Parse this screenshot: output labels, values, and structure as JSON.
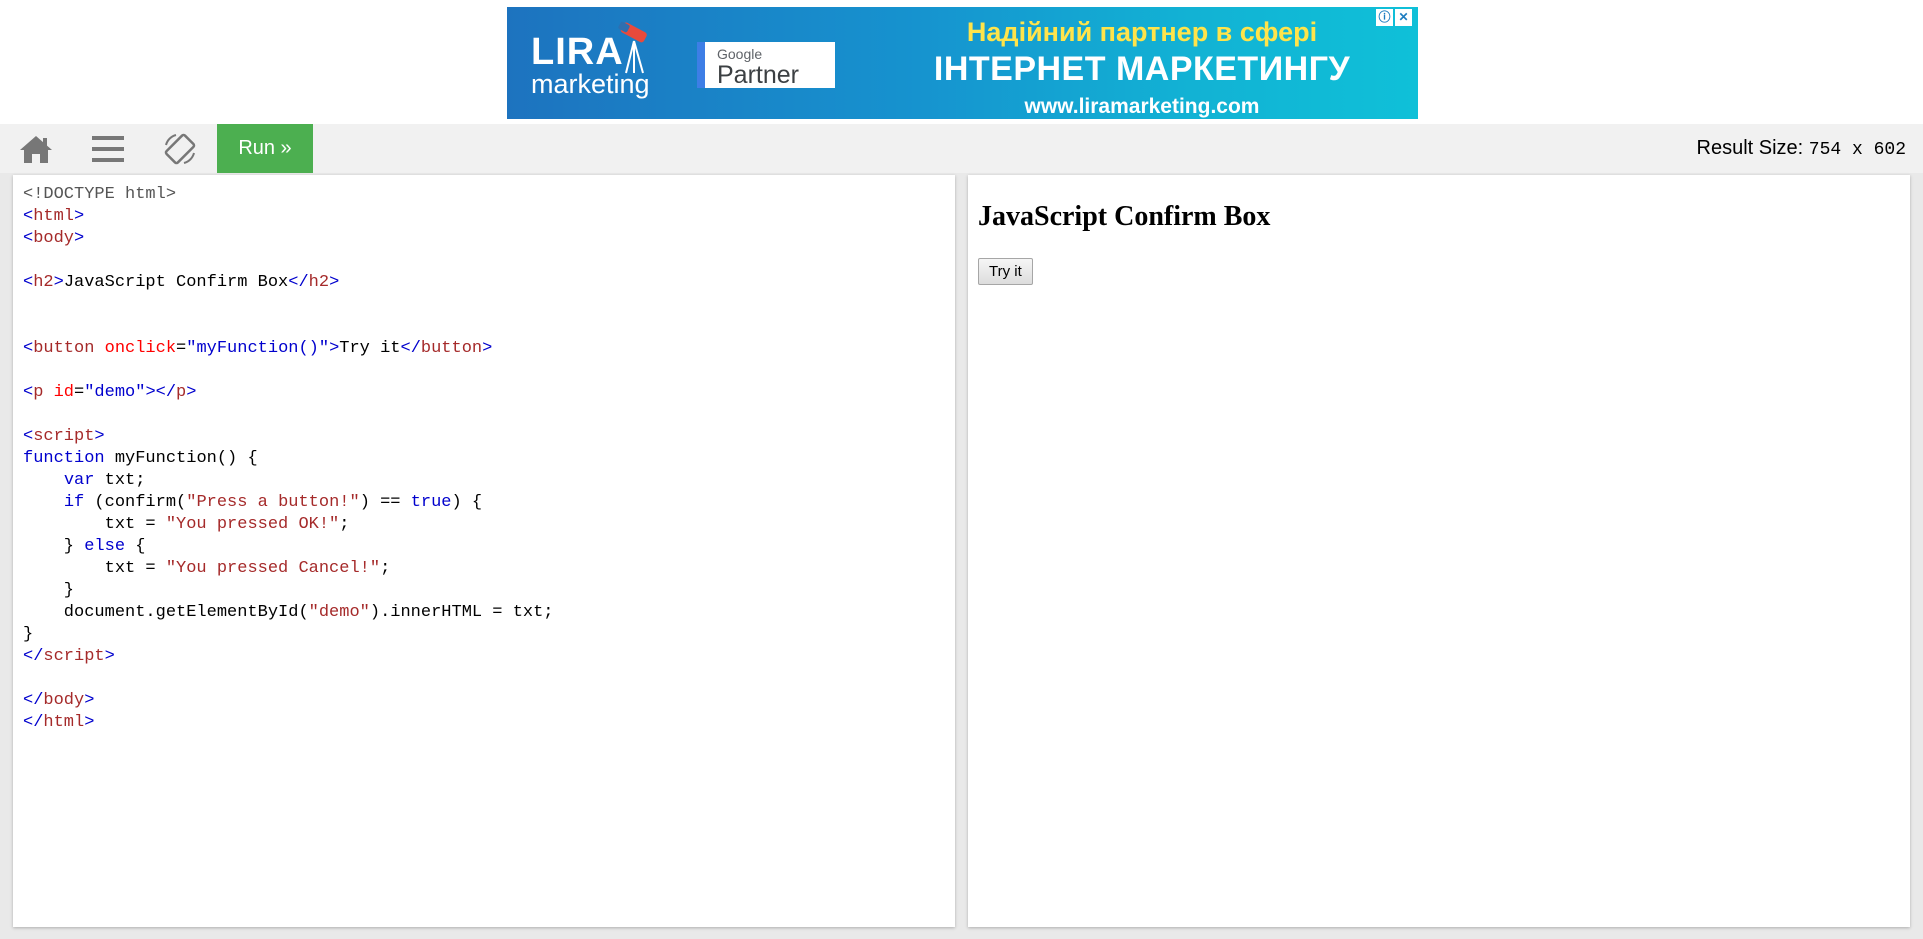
{
  "ad": {
    "logo_main": "LIRA",
    "logo_sub": "marketing",
    "partner_google": "Google",
    "partner_label": "Partner",
    "headline_line1": "Надійний партнер в сфері",
    "headline_line2": "ІНТЕРНЕТ МАРКЕТИНГУ",
    "headline_line3": "www.liramarketing.com",
    "info_glyph": "ⓘ",
    "close_glyph": "✕"
  },
  "toolbar": {
    "home_icon": "home-icon",
    "menu_icon": "menu-icon",
    "rotate_icon": "rotate-icon",
    "run_label": "Run »",
    "result_size_label": "Result Size:",
    "result_size_value": "754 x 602"
  },
  "colors": {
    "run_button": "#4caf50",
    "toolbar_bg": "#f1f1f1",
    "code_tag": "#0000cd",
    "code_name": "#a52a2a",
    "code_attr": "#ff0000"
  },
  "code_lines": [
    [
      [
        "doc",
        "<!DOCTYPE html>"
      ]
    ],
    [
      [
        "tag",
        "<"
      ],
      [
        "name",
        "html"
      ],
      [
        "tag",
        ">"
      ]
    ],
    [
      [
        "tag",
        "<"
      ],
      [
        "name",
        "body"
      ],
      [
        "tag",
        ">"
      ]
    ],
    [],
    [
      [
        "tag",
        "<"
      ],
      [
        "name",
        "h2"
      ],
      [
        "tag",
        ">"
      ],
      [
        "plain",
        "JavaScript Confirm Box"
      ],
      [
        "tag",
        "</"
      ],
      [
        "name",
        "h2"
      ],
      [
        "tag",
        ">"
      ]
    ],
    [],
    [],
    [
      [
        "tag",
        "<"
      ],
      [
        "name",
        "button"
      ],
      [
        "plain",
        " "
      ],
      [
        "attr",
        "onclick"
      ],
      [
        "plain",
        "="
      ],
      [
        "val",
        "\"myFunction()\""
      ],
      [
        "tag",
        ">"
      ],
      [
        "plain",
        "Try it"
      ],
      [
        "tag",
        "</"
      ],
      [
        "name",
        "button"
      ],
      [
        "tag",
        ">"
      ]
    ],
    [],
    [
      [
        "tag",
        "<"
      ],
      [
        "name",
        "p"
      ],
      [
        "plain",
        " "
      ],
      [
        "attr",
        "id"
      ],
      [
        "plain",
        "="
      ],
      [
        "val",
        "\"demo\""
      ],
      [
        "tag",
        "></"
      ],
      [
        "name",
        "p"
      ],
      [
        "tag",
        ">"
      ]
    ],
    [],
    [
      [
        "tag",
        "<"
      ],
      [
        "name",
        "script"
      ],
      [
        "tag",
        ">"
      ]
    ],
    [
      [
        "kw",
        "function"
      ],
      [
        "plain",
        " myFunction() {"
      ]
    ],
    [
      [
        "plain",
        "    "
      ],
      [
        "kw",
        "var"
      ],
      [
        "plain",
        " txt;"
      ]
    ],
    [
      [
        "plain",
        "    "
      ],
      [
        "kw",
        "if"
      ],
      [
        "plain",
        " (confirm("
      ],
      [
        "str",
        "\"Press a button!\""
      ],
      [
        "plain",
        ") == "
      ],
      [
        "kw",
        "true"
      ],
      [
        "plain",
        ") {"
      ]
    ],
    [
      [
        "plain",
        "        txt = "
      ],
      [
        "str",
        "\"You pressed OK!\""
      ],
      [
        "plain",
        ";"
      ]
    ],
    [
      [
        "plain",
        "    } "
      ],
      [
        "kw",
        "else"
      ],
      [
        "plain",
        " {"
      ]
    ],
    [
      [
        "plain",
        "        txt = "
      ],
      [
        "str",
        "\"You pressed Cancel!\""
      ],
      [
        "plain",
        ";"
      ]
    ],
    [
      [
        "plain",
        "    }"
      ]
    ],
    [
      [
        "plain",
        "    document.getElementById("
      ],
      [
        "str",
        "\"demo\""
      ],
      [
        "plain",
        ").innerHTML = txt;"
      ]
    ],
    [
      [
        "plain",
        "}"
      ]
    ],
    [
      [
        "tag",
        "</"
      ],
      [
        "name",
        "script"
      ],
      [
        "tag",
        ">"
      ]
    ],
    [],
    [
      [
        "tag",
        "</"
      ],
      [
        "name",
        "body"
      ],
      [
        "tag",
        ">"
      ]
    ],
    [
      [
        "tag",
        "</"
      ],
      [
        "name",
        "html"
      ],
      [
        "tag",
        ">"
      ]
    ]
  ],
  "result": {
    "heading": "JavaScript Confirm Box",
    "button_label": "Try it"
  }
}
